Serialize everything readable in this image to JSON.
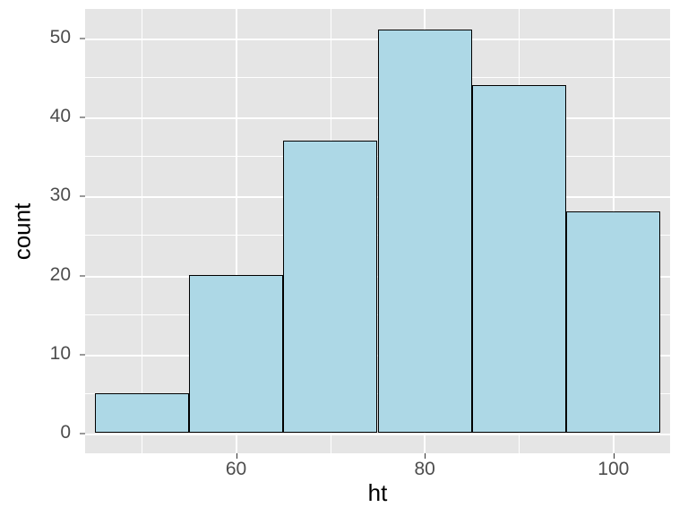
{
  "chart_data": {
    "type": "bar",
    "subtype": "histogram",
    "title": "",
    "xlabel": "ht",
    "ylabel": "count",
    "bin_edges": [
      45,
      55,
      65,
      75,
      85,
      95,
      105
    ],
    "bin_centers": [
      50,
      60,
      70,
      80,
      90,
      100
    ],
    "values": [
      5,
      20,
      37,
      51,
      44,
      28
    ],
    "x_ticks": [
      60,
      80,
      100
    ],
    "y_ticks": [
      0,
      10,
      20,
      30,
      40,
      50
    ],
    "xlim": [
      44,
      106
    ],
    "ylim": [
      -2.6,
      53.6
    ],
    "bar_fill": "#add8e6",
    "bar_stroke": "#000000",
    "panel_bg": "#e5e5e5",
    "grid_color": "#ffffff"
  }
}
